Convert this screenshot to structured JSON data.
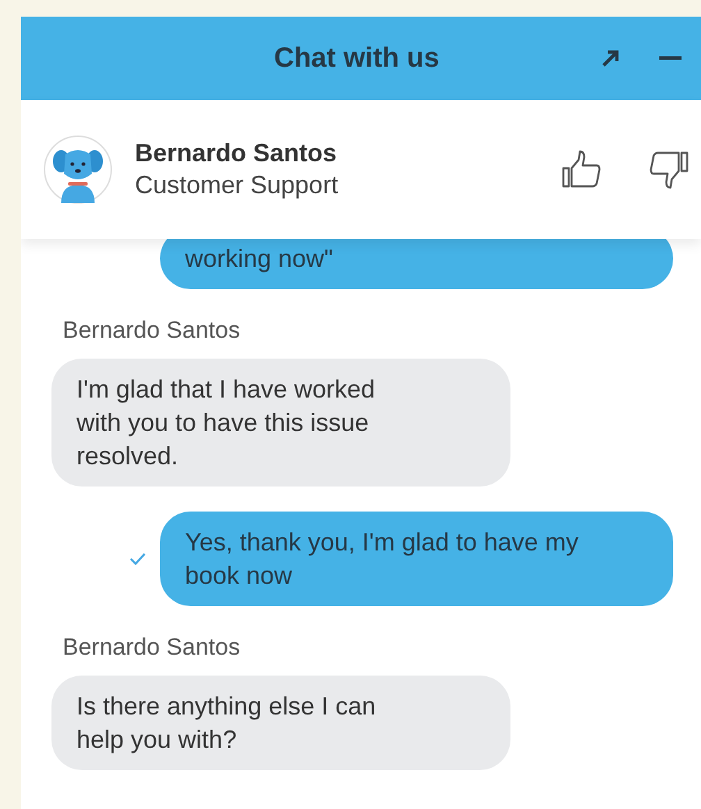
{
  "header": {
    "title": "Chat with us"
  },
  "agent": {
    "name": "Bernardo Santos",
    "role": "Customer Support"
  },
  "messages": [
    {
      "kind": "sent",
      "text": "working now\"",
      "clipped": true
    },
    {
      "kind": "received",
      "sender": "Bernardo Santos",
      "text": "I'm glad that I have worked with you to have this issue resolved."
    },
    {
      "kind": "sent",
      "text": "Yes, thank you, I'm glad to have my book now",
      "delivered": true
    },
    {
      "kind": "received",
      "sender": "Bernardo Santos",
      "text": "Is there anything else I can help you with?"
    }
  ]
}
